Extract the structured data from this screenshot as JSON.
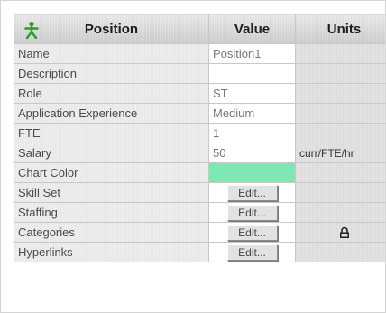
{
  "header": {
    "position_label": "Position",
    "value_label": "Value",
    "units_label": "Units",
    "icon": "person-icon"
  },
  "colors": {
    "chart_color_value": "#7de8b4",
    "header_icon": "#2e9e2e"
  },
  "rows": [
    {
      "label": "Name",
      "value": "Position1",
      "units": ""
    },
    {
      "label": "Description",
      "value": "",
      "units": ""
    },
    {
      "label": "Role",
      "value": "ST",
      "units": ""
    },
    {
      "label": "Application Experience",
      "value": "Medium",
      "units": ""
    },
    {
      "label": "FTE",
      "value": "1",
      "units": ""
    },
    {
      "label": "Salary",
      "value": "50",
      "units": "curr/FTE/hr"
    },
    {
      "label": "Chart Color",
      "value": "",
      "units": ""
    },
    {
      "label": "Skill Set",
      "value": "Edit...",
      "units": ""
    },
    {
      "label": "Staffing",
      "value": "Edit...",
      "units": ""
    },
    {
      "label": "Categories",
      "value": "Edit...",
      "units": "",
      "units_icon": "lock-icon"
    },
    {
      "label": "Hyperlinks",
      "value": "Edit...",
      "units": ""
    }
  ]
}
